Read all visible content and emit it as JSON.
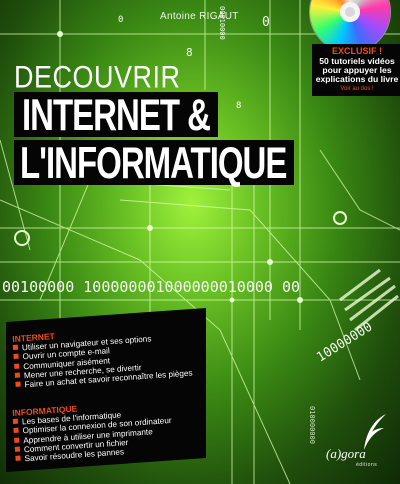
{
  "cover": {
    "author": "Antoine RIGAUT",
    "series": "DECOUVRIR",
    "title_line1": "INTERNET &",
    "title_line2": "L'INFORMATIQUE",
    "publisher": "(a)gora",
    "publisher_sub": "éditions",
    "colors": {
      "accent": "#f04a1a",
      "background": "#6bc224",
      "panel": "#050505"
    }
  },
  "promo": {
    "exclusive": "EXCLUSIF !",
    "description": "50 tutoriels vidéos pour appuyer les explications du livre",
    "see_back": "Voir au dos !"
  },
  "background_text": {
    "binary_row": "00100000 100000001000000010000 00",
    "binary_diag": "10000000",
    "binary_top": "00010000",
    "binary_small": "010000000",
    "digit_a": "8",
    "digit_b": "0",
    "digit_c": "0",
    "digit_d": "8"
  },
  "contents": {
    "internet": {
      "heading": "INTERNET",
      "items": [
        "Utiliser un navigateur et ses options",
        "Ouvrir un compte e-mail",
        "Communiquer aisément",
        "Mener une recherche, se divertir",
        "Faire un achat et savoir reconnaître les pièges"
      ]
    },
    "informatique": {
      "heading": "INFORMATIQUE",
      "items": [
        "Les bases de l'informatique",
        "Optimiser la connexion de son ordinateur",
        "Apprendre à utiliser une imprimante",
        "Comment convertir un fichier",
        "Savoir résoudre les pannes"
      ]
    }
  }
}
